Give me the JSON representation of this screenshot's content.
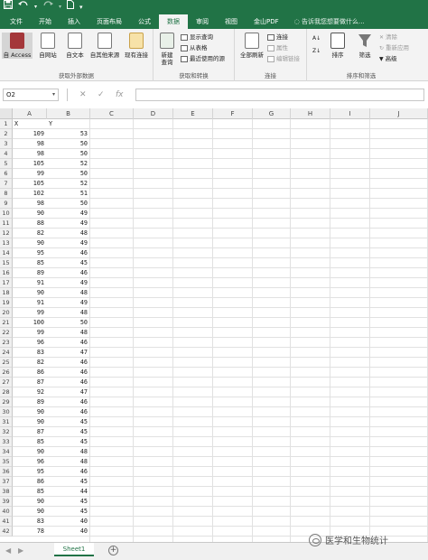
{
  "quick_access": {
    "save_icon": "save-icon",
    "undo_icon": "undo-icon",
    "redo_icon": "redo-icon",
    "new_icon": "new-file-icon",
    "customize_glyph": "▾"
  },
  "tabs": [
    {
      "label": "文件"
    },
    {
      "label": "开始"
    },
    {
      "label": "插入"
    },
    {
      "label": "页面布局"
    },
    {
      "label": "公式"
    },
    {
      "label": "数据",
      "active": true
    },
    {
      "label": "审阅"
    },
    {
      "label": "视图"
    },
    {
      "label": "金山PDF"
    }
  ],
  "tell_me": "告诉我您想要做什么...",
  "ribbon": {
    "get_external": {
      "label": "获取外部数据",
      "from_access": "自 Access",
      "from_web": "自网站",
      "from_text": "自文本",
      "from_other": "自其他来源",
      "existing": "现有连接"
    },
    "get_transform": {
      "label": "获取和转换",
      "new_query": "新建",
      "new_query_2": "查询",
      "show_queries": "显示查询",
      "from_table": "从表格",
      "recent_sources": "最近使用的源"
    },
    "connections": {
      "label": "连接",
      "refresh_all": "全部刷新",
      "connections": "连接",
      "properties": "属性",
      "edit_links": "编辑链接"
    },
    "sort_filter": {
      "label": "排序和筛选",
      "sort": "排序",
      "filter": "筛选",
      "clear": "清除",
      "reapply": "重新应用",
      "advanced": "高级"
    }
  },
  "formula_bar": {
    "name_box": "O2",
    "cancel_glyph": "✕",
    "enter_glyph": "✓",
    "fx_glyph": "fx",
    "formula": ""
  },
  "columns": [
    "A",
    "B",
    "C",
    "D",
    "E",
    "F",
    "G",
    "H",
    "I",
    "J"
  ],
  "rows": [
    {
      "n": "1",
      "a": "X",
      "b": "Y"
    },
    {
      "n": "2",
      "a": "109",
      "b": "53"
    },
    {
      "n": "3",
      "a": "98",
      "b": "50"
    },
    {
      "n": "4",
      "a": "98",
      "b": "50"
    },
    {
      "n": "5",
      "a": "105",
      "b": "52"
    },
    {
      "n": "6",
      "a": "99",
      "b": "50"
    },
    {
      "n": "7",
      "a": "105",
      "b": "52"
    },
    {
      "n": "8",
      "a": "102",
      "b": "51"
    },
    {
      "n": "9",
      "a": "98",
      "b": "50"
    },
    {
      "n": "10",
      "a": "90",
      "b": "49"
    },
    {
      "n": "11",
      "a": "88",
      "b": "49"
    },
    {
      "n": "12",
      "a": "82",
      "b": "48"
    },
    {
      "n": "13",
      "a": "90",
      "b": "49"
    },
    {
      "n": "14",
      "a": "95",
      "b": "46"
    },
    {
      "n": "15",
      "a": "85",
      "b": "45"
    },
    {
      "n": "16",
      "a": "89",
      "b": "46"
    },
    {
      "n": "17",
      "a": "91",
      "b": "49"
    },
    {
      "n": "18",
      "a": "90",
      "b": "48"
    },
    {
      "n": "19",
      "a": "91",
      "b": "49"
    },
    {
      "n": "20",
      "a": "99",
      "b": "48"
    },
    {
      "n": "21",
      "a": "100",
      "b": "50"
    },
    {
      "n": "22",
      "a": "99",
      "b": "48"
    },
    {
      "n": "23",
      "a": "96",
      "b": "46"
    },
    {
      "n": "24",
      "a": "83",
      "b": "47"
    },
    {
      "n": "25",
      "a": "82",
      "b": "46"
    },
    {
      "n": "26",
      "a": "86",
      "b": "46"
    },
    {
      "n": "27",
      "a": "87",
      "b": "46"
    },
    {
      "n": "28",
      "a": "92",
      "b": "47"
    },
    {
      "n": "29",
      "a": "89",
      "b": "46"
    },
    {
      "n": "30",
      "a": "90",
      "b": "46"
    },
    {
      "n": "31",
      "a": "90",
      "b": "45"
    },
    {
      "n": "32",
      "a": "87",
      "b": "45"
    },
    {
      "n": "33",
      "a": "85",
      "b": "45"
    },
    {
      "n": "34",
      "a": "90",
      "b": "48"
    },
    {
      "n": "35",
      "a": "96",
      "b": "48"
    },
    {
      "n": "36",
      "a": "95",
      "b": "46"
    },
    {
      "n": "37",
      "a": "86",
      "b": "45"
    },
    {
      "n": "38",
      "a": "85",
      "b": "44"
    },
    {
      "n": "39",
      "a": "90",
      "b": "45"
    },
    {
      "n": "40",
      "a": "90",
      "b": "45"
    },
    {
      "n": "41",
      "a": "83",
      "b": "40"
    },
    {
      "n": "42",
      "a": "78",
      "b": "40"
    }
  ],
  "sheet_tab": "Sheet1",
  "add_sheet_glyph": "+",
  "watermark": "医学和生物统计"
}
